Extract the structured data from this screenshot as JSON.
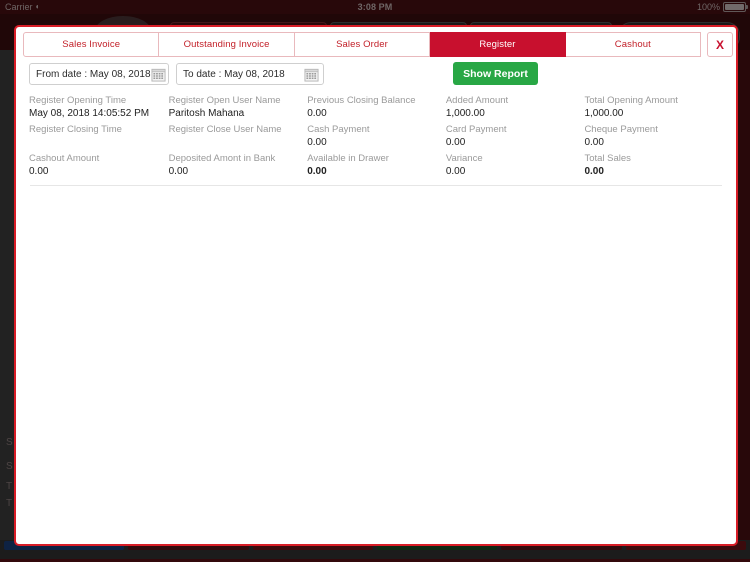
{
  "status_bar": {
    "carrier": "Carrier",
    "wifi_icon": "wifi-icon",
    "time": "3:08 PM",
    "battery_percent": "100%",
    "battery_icon": "battery-full-icon"
  },
  "modal": {
    "tabs": [
      {
        "label": "Sales Invoice",
        "active": false
      },
      {
        "label": "Outstanding Invoice",
        "active": false
      },
      {
        "label": "Sales Order",
        "active": false
      },
      {
        "label": "Register",
        "active": true
      },
      {
        "label": "Cashout",
        "active": false
      }
    ],
    "close_label": "X",
    "filters": {
      "from_date": "From date : May 08, 2018",
      "to_date": "To date : May 08, 2018",
      "calendar_icon": "calendar-icon",
      "show_report_label": "Show Report"
    },
    "report": {
      "rows": [
        [
          {
            "label": "Register Opening Time",
            "value": "May 08, 2018 14:05:52 PM",
            "bold": false
          },
          {
            "label": "Register Open User Name",
            "value": "Paritosh Mahana",
            "bold": false
          },
          {
            "label": "Previous Closing Balance",
            "value": "0.00",
            "bold": false
          },
          {
            "label": "Added Amount",
            "value": "1,000.00",
            "bold": false
          },
          {
            "label": "Total Opening Amount",
            "value": "1,000.00",
            "bold": false
          }
        ],
        [
          {
            "label": "Register Closing Time",
            "value": "",
            "bold": false
          },
          {
            "label": "Register Close User Name",
            "value": "",
            "bold": false
          },
          {
            "label": "Cash Payment",
            "value": "0.00",
            "bold": false
          },
          {
            "label": "Card Payment",
            "value": "0.00",
            "bold": false
          },
          {
            "label": "Cheque Payment",
            "value": "0.00",
            "bold": false
          }
        ],
        [
          {
            "label": "Cashout Amount",
            "value": "0.00",
            "bold": false
          },
          {
            "label": "Deposited Amont in Bank",
            "value": "0.00",
            "bold": false
          },
          {
            "label": "Available in Drawer",
            "value": "0.00",
            "bold": true
          },
          {
            "label": "Variance",
            "value": "0.00",
            "bold": false
          },
          {
            "label": "Total Sales",
            "value": "0.00",
            "bold": true
          }
        ]
      ]
    }
  },
  "background": {
    "side_labels": [
      "S",
      "S",
      "T",
      "T"
    ]
  },
  "colors": {
    "brand_red": "#c8102e",
    "modal_border": "#d81c26",
    "tab_text": "#c21f28",
    "success_green": "#28a745",
    "label_grey": "#9a9a9a",
    "value_dark": "#222222",
    "app_dark_red": "#4a1013"
  }
}
